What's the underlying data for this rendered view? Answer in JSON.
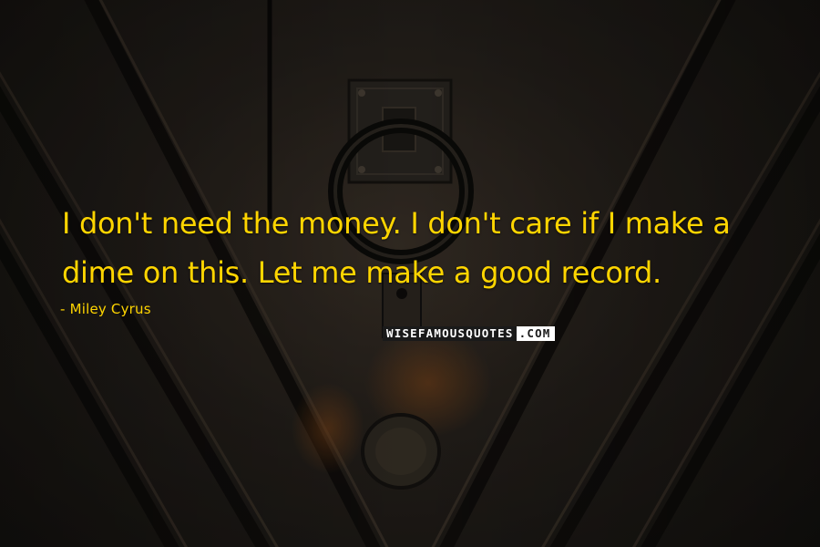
{
  "quote": {
    "text": "I don't need the money. I don't care if I make a dime on this. Let me make a good record.",
    "author": "- Miley Cyrus"
  },
  "watermark": {
    "main": "WISEFAMOUSQUOTES",
    "suffix": ".COM"
  },
  "colors": {
    "text": "#ffd500",
    "background": "#26211c"
  },
  "background_image": "dark wooden door with metal ring knocker"
}
